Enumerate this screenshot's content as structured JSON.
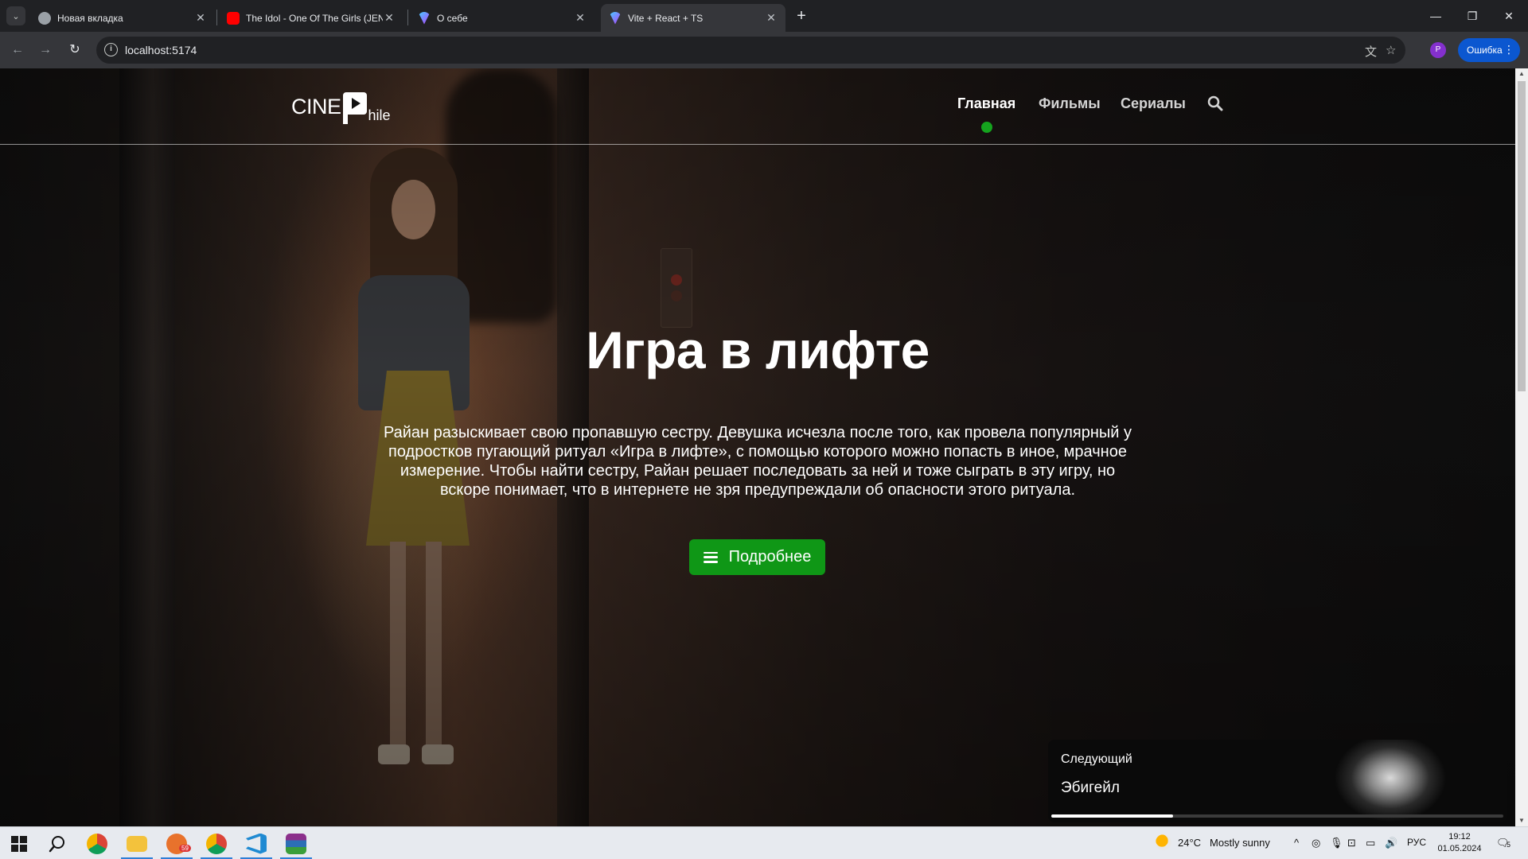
{
  "browser": {
    "tabs": [
      {
        "title": "Новая вкладка",
        "icon": "chrome-icon",
        "active": false
      },
      {
        "title": "The Idol - One Of The Girls (JENNIE",
        "icon": "youtube-icon",
        "active": false
      },
      {
        "title": "О себе",
        "icon": "vite-icon",
        "active": false
      },
      {
        "title": "Vite + React + TS",
        "icon": "vite-icon",
        "active": true
      }
    ],
    "url": "localhost:5174",
    "profile_initial": "P",
    "error_label": "Ошибка",
    "controls": {
      "tab_close": "✕",
      "new_tab": "+",
      "minimize": "—",
      "restore": "❐",
      "close": "✕",
      "back": "←",
      "forward": "→",
      "reload": "↻",
      "menu": "⋮",
      "search": "⌄"
    }
  },
  "site": {
    "logo": {
      "part1": "CINE",
      "part2": "hile"
    },
    "nav": [
      {
        "label": "Главная",
        "active": true
      },
      {
        "label": "Фильмы",
        "active": false
      },
      {
        "label": "Сериалы",
        "active": false
      }
    ],
    "hero": {
      "title": "Игра в лифте",
      "description": "Райан разыскивает свою пропавшую сестру. Девушка исчезла после того, как провела популярный у подростков пугающий ритуал «Игра в лифте», с помощью которого можно попасть в иное, мрачное измерение. Чтобы найти сестру, Райан решает последовать за ней и тоже сыграть в эту игру, но вскоре понимает, что в интернете не зря предупреждали об опасности этого ритуала.",
      "button_label": "Подробнее"
    },
    "next": {
      "label": "Следующий",
      "title": "Эбигейл",
      "progress": 0.27
    },
    "accent_color": "#0f9716"
  },
  "taskbar": {
    "weather_temp": "24°C",
    "weather_text": "Mostly sunny",
    "language": "РУС",
    "time": "19:12",
    "date": "01.05.2024",
    "notification_count": "5",
    "badge_count": "59"
  }
}
